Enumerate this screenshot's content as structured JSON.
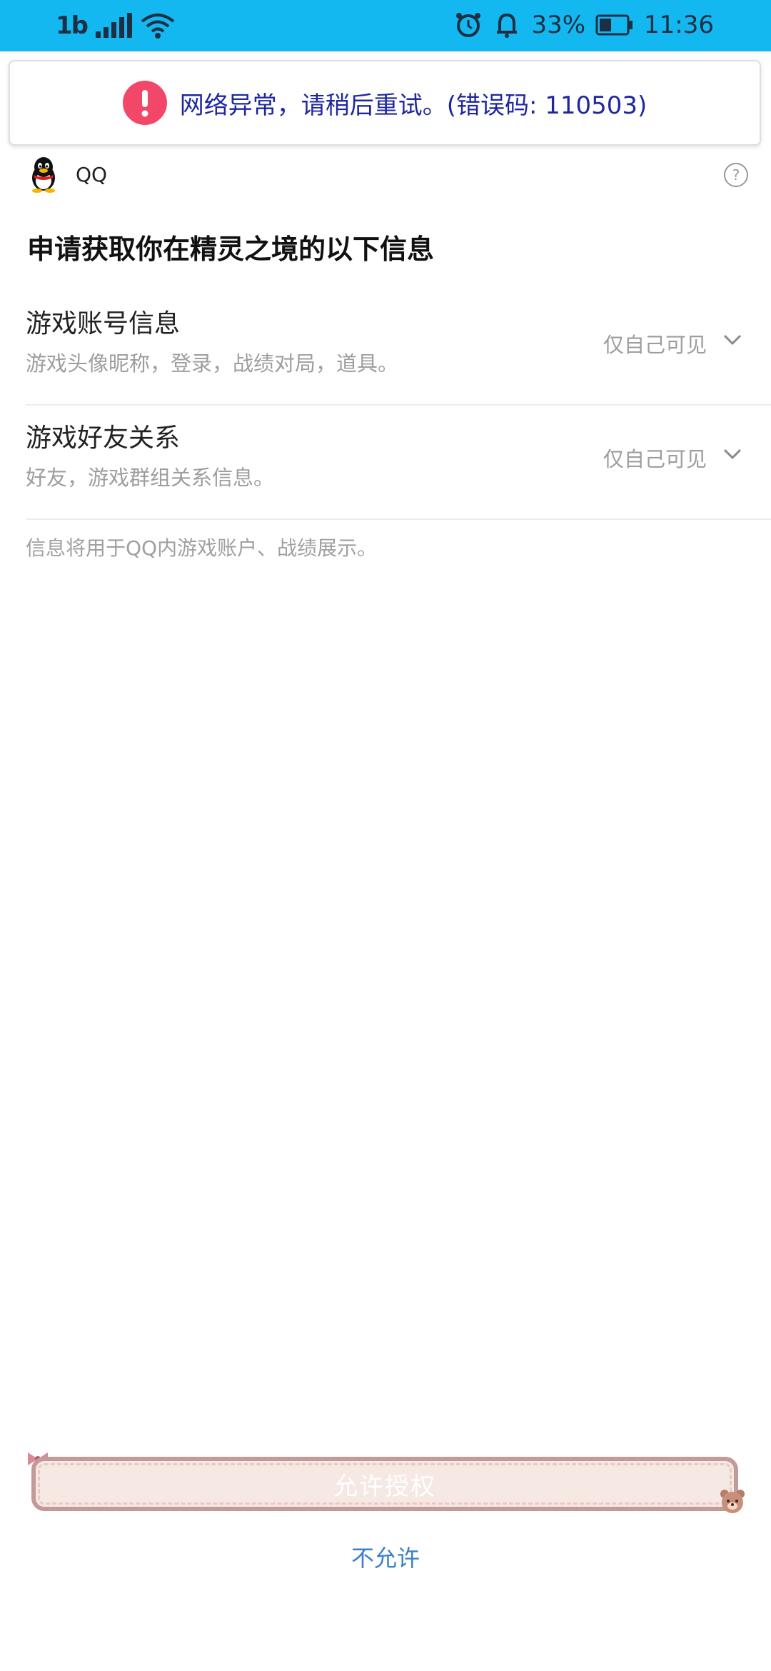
{
  "status_bar": {
    "network": "1b",
    "battery_percent": "33%",
    "time": "11:36",
    "icons": [
      "signal-icon",
      "wifi-icon",
      "alarm-icon",
      "bell-icon",
      "battery-icon"
    ]
  },
  "toast": {
    "icon": "error-icon",
    "message": "网络异常，请稍后重试。(错误码: 110503)"
  },
  "app": {
    "name": "QQ",
    "logo": "qq-penguin-logo",
    "help_icon": "?"
  },
  "page_title": "申请获取你在精灵之境的以下信息",
  "permissions": [
    {
      "title": "游戏账号信息",
      "description": "游戏头像昵称，登录，战绩对局，道具。",
      "visibility": "仅自己可见"
    },
    {
      "title": "游戏好友关系",
      "description": "好友，游戏群组关系信息。",
      "visibility": "仅自己可见"
    }
  ],
  "note": "信息将用于QQ内游戏账户、战绩展示。",
  "buttons": {
    "allow": "允许授权",
    "deny": "不允许"
  },
  "colors": {
    "status_bar": "#13b8f0",
    "error_icon": "#f3476a",
    "toast_text": "#1f27a0",
    "deny_link": "#3a7fc8",
    "allow_button_fill": "#f6e8e3",
    "allow_button_border": "#c49a99"
  }
}
